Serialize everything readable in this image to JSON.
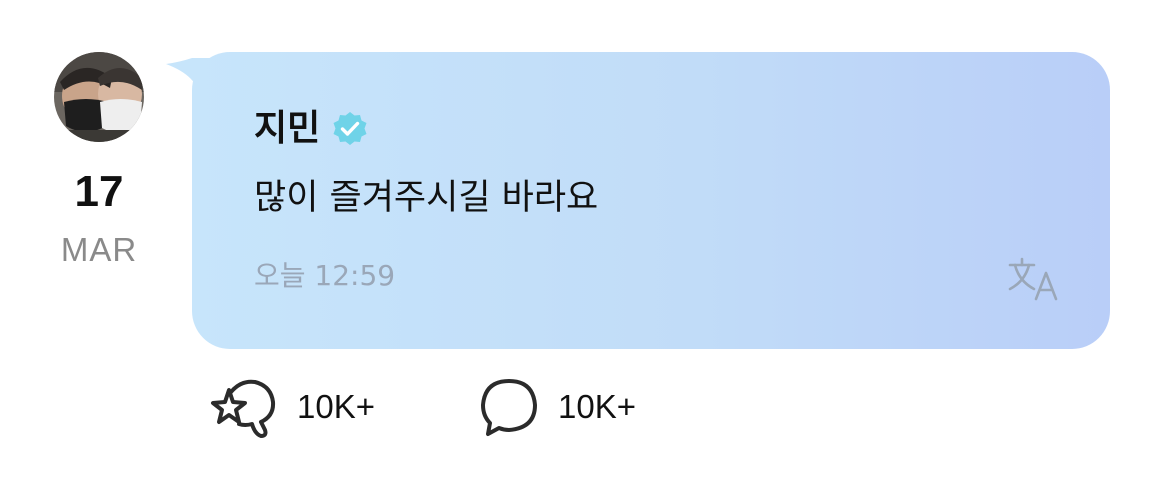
{
  "post": {
    "author": "지민",
    "verified": true,
    "message": "많이 즐겨주시길 바라요",
    "timestamp": "오늘 12:59",
    "date": {
      "day": "17",
      "month": "MAR"
    },
    "icons": {
      "avatar": "profile-photo-avatar",
      "verified": "verified-badge-icon",
      "translate": "translate-icon"
    },
    "colors": {
      "bubble_start": "#c7e5fb",
      "bubble_end": "#b9cef8",
      "verified": "#6fd3e8",
      "timestamp": "#9aa7b8",
      "month": "#8a8a8a"
    }
  },
  "actions": {
    "like": {
      "icon": "star-bubble-icon",
      "count": "10K+"
    },
    "comment": {
      "icon": "speech-bubble-icon",
      "count": "10K+"
    }
  }
}
